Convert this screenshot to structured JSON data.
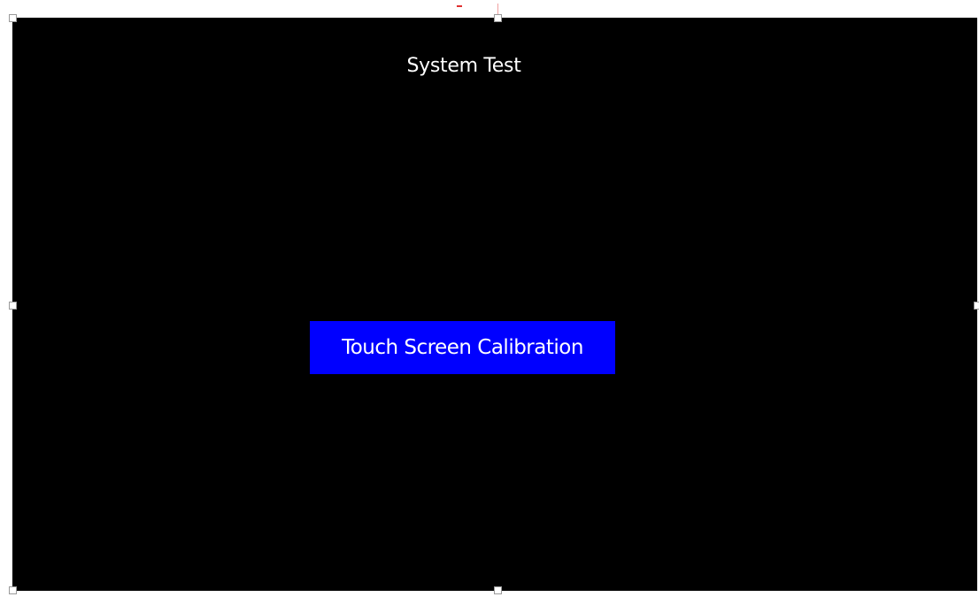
{
  "screen": {
    "title": "System Test",
    "background_color": "#000000"
  },
  "calibration_button": {
    "label": "Touch Screen Calibration",
    "color": "#0000ff"
  },
  "selection_handles": [
    "top-left-handle",
    "top-center-handle",
    "middle-left-handle",
    "middle-right-handle",
    "bottom-left-handle",
    "bottom-center-handle"
  ]
}
